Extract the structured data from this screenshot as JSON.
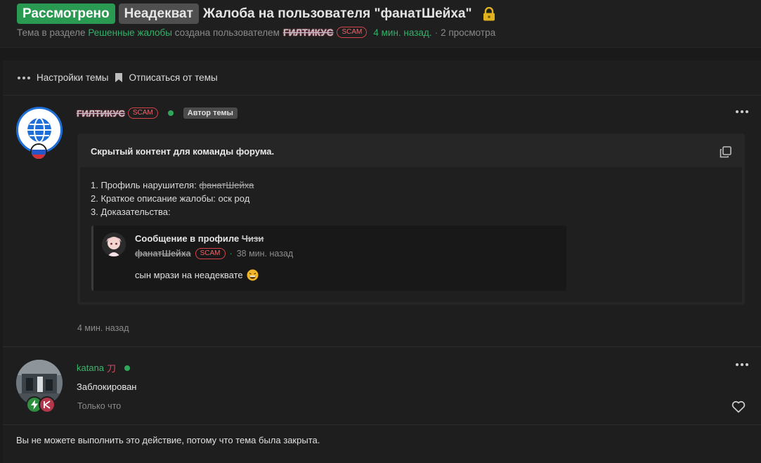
{
  "thread": {
    "prefix_status": "Рассмотрено",
    "prefix_type": "Неадекват",
    "title": "Жалоба на пользователя \"фанатШейха\"",
    "meta": {
      "topic_in_section": "Тема в разделе",
      "section": "Решенные жалобы",
      "created_by": "создана пользователем",
      "author": "ГИЛТИКУС",
      "author_badge": "SCAM",
      "time_ago": "4 мин. назад.",
      "views": "2 просмотра"
    }
  },
  "toolbar": {
    "settings_label": "Настройки темы",
    "unsubscribe_label": "Отписаться от темы"
  },
  "post1": {
    "author": "ГИЛТИКУС",
    "author_badge": "SCAM",
    "author_tag": "Автор темы",
    "hidden_title": "Скрытый контент для команды форума.",
    "line1_prefix": "1. Профиль нарушителя: ",
    "line1_name": "фанатШейха",
    "line2": "2. Краткое описание жалобы: оск род",
    "line3": "3. Доказательства:",
    "quote": {
      "head_prefix": "Сообщение в профиле ",
      "head_name": "Чизи",
      "poster": "фанатШейха",
      "poster_badge": "SCAM",
      "time": "38 мин. назад",
      "message": "сын мрази на неадеквате"
    },
    "time": "4 мин. назад"
  },
  "post2": {
    "author": "katana",
    "author_glyph": "刀",
    "text": "Заблокирован",
    "time": "Только что"
  },
  "closed_note": "Вы не можете выполнить это действие, потому что тема была закрыта.",
  "colors": {
    "accent_green": "#2a9a52",
    "link_green": "#33b06a",
    "scam_red": "#d3454b",
    "online": "#2fa65a"
  }
}
